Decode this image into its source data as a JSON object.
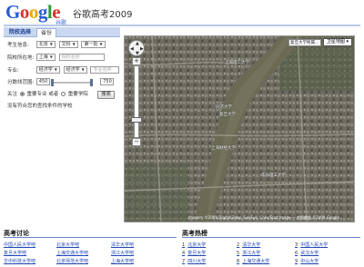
{
  "header": {
    "logo": {
      "G": "G",
      "o1": "o",
      "o2": "o",
      "g": "g",
      "l": "l",
      "e": "e",
      "sub": "谷歌"
    },
    "title": "谷歌高考2009"
  },
  "panel": {
    "tabs": [
      {
        "label": "院校选择"
      },
      {
        "label": "省份"
      }
    ],
    "rows": [
      {
        "label": "考生信息:",
        "selects": [
          "北京",
          "文科",
          "第一批"
        ]
      },
      {
        "label": "院校所在地:",
        "selects": [
          "上海"
        ],
        "input_placeholder": "院校名称"
      },
      {
        "label": "专业:",
        "selects": [
          "经济学",
          "经济学"
        ],
        "input_placeholder": "专业名称"
      }
    ],
    "score": {
      "label": "分数线范围:",
      "min": "450",
      "max": "750",
      "min_fraction": 0.0,
      "max_fraction": 1.0
    },
    "options": {
      "prefix": "关注",
      "opt1": "重要专业",
      "connector": "或者",
      "opt2": "重要学院"
    },
    "search_button": "搜索",
    "note": "没有符合您的查找条件的学校"
  },
  "map": {
    "type_button": "卫星地图",
    "labels": [
      {
        "text": "复旦大学附属…"
      },
      {
        "text": "上海理工大学"
      },
      {
        "text": "同济大学"
      },
      {
        "text": "复旦大学"
      },
      {
        "text": "上海财经大学"
      },
      {
        "text": "华东理工大学"
      }
    ],
    "copyright": "Imagery ©2009 DigitalGlobe, GeoEye, Cnes/Spot Image — 地图数据 ©2009 Google"
  },
  "discussion": {
    "title": "高考讨论",
    "links": [
      [
        "中国人民大学吧",
        "北京大学吧",
        "清华大学吧"
      ],
      [
        "复旦大学吧",
        "上海交通大学吧",
        "浙江大学吧"
      ],
      [
        "华中科技大学吧",
        "北京师范大学吧",
        "上海大学吧"
      ]
    ]
  },
  "hot": {
    "title": "高考热榜",
    "items": [
      [
        "1",
        "北京大学",
        "2",
        "清华大学",
        "3",
        "中国人民大学"
      ],
      [
        "4",
        "复旦大学",
        "5",
        "浙江大学",
        "6",
        "武汉大学"
      ],
      [
        "7",
        "四川大学",
        "8",
        "上海交通大学",
        "9",
        "中山大学"
      ]
    ]
  }
}
